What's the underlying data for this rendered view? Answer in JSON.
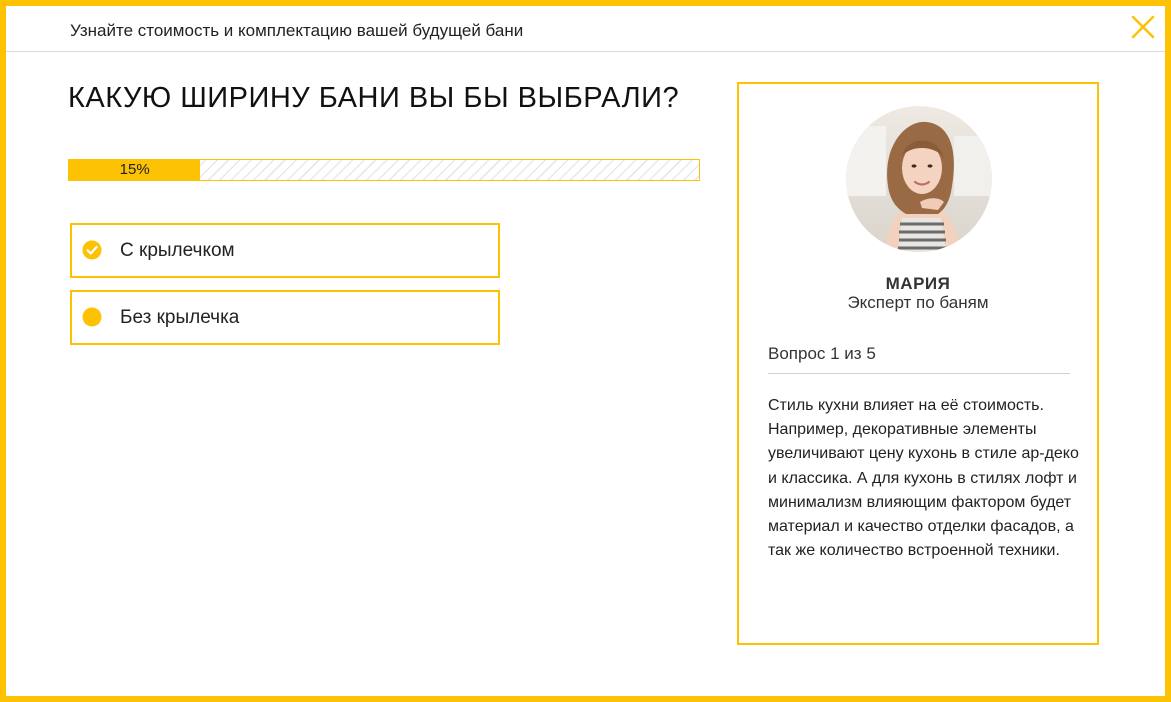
{
  "header": {
    "title": "Узнайте стоимость и комплектацию вашей будущей бани",
    "close_icon": "close-icon"
  },
  "quiz": {
    "question": "КАКУЮ ШИРИНУ БАНИ ВЫ БЫ ВЫБРАЛИ?",
    "progress": {
      "percent": 15,
      "label": "15%"
    },
    "options": [
      {
        "label": "С крылечком",
        "icon": "check-circle-icon",
        "selected": true
      },
      {
        "label": "Без крылечка",
        "icon": "dot-circle-icon",
        "selected": false
      }
    ]
  },
  "expert": {
    "avatar_icon": "avatar",
    "name": "МАРИЯ",
    "role": "Эксперт по баням",
    "counter": "Вопрос 1 из 5",
    "tip": "Стиль кухни влияет на её стоимость. Например, декоративные элементы увеличивают цену кухонь в стиле ар-деко и классика. А для кухонь в стилях лофт и минимализм влияющим фактором будет материал и качество отделки фасадов, а так же количество встроенной техники."
  },
  "colors": {
    "accent": "#fcc203",
    "text": "#222222",
    "divider": "#d9d9d9"
  }
}
